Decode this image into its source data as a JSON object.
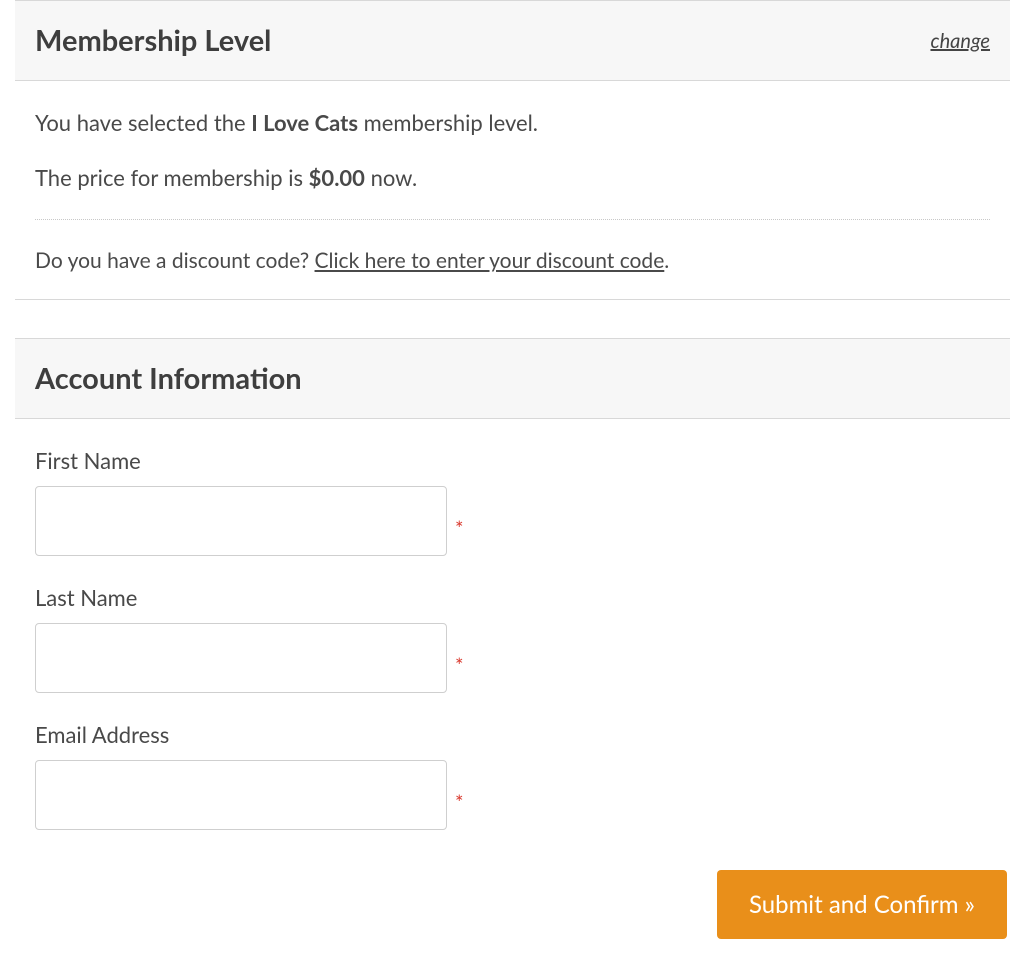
{
  "membership": {
    "header_title": "Membership Level",
    "change_label": "change",
    "selected_prefix": "You have selected the ",
    "selected_level": "I Love Cats",
    "selected_suffix": " membership level.",
    "price_prefix": "The price for membership is ",
    "price_value": "$0.00",
    "price_suffix": " now.",
    "discount_question": "Do you have a discount code? ",
    "discount_link": "Click here to enter your discount code",
    "discount_period": "."
  },
  "account": {
    "header_title": "Account Information",
    "first_name_label": "First Name",
    "first_name_value": "",
    "last_name_label": "Last Name",
    "last_name_value": "",
    "email_label": "Email Address",
    "email_value": "",
    "required_mark": "*"
  },
  "actions": {
    "submit_label": "Submit and Confirm »"
  }
}
